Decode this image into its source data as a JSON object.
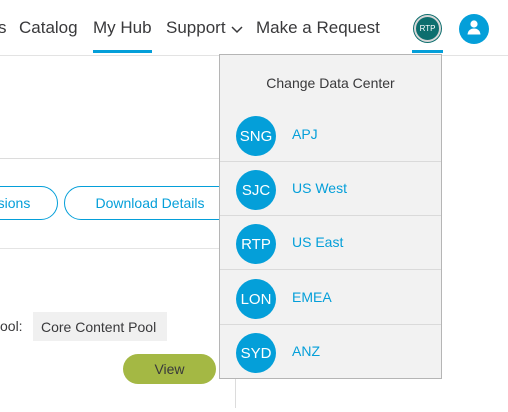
{
  "nav": {
    "partial_item": "s",
    "catalog": "Catalog",
    "my_hub": "My Hub",
    "support": "Support",
    "make_request": "Make a Request",
    "datacenter_badge": "RTP"
  },
  "content": {
    "partial_button": "sions",
    "download_details": "Download Details",
    "pool_label": "ool:",
    "pool_value": "Core Content Pool",
    "view_button": "View"
  },
  "datacenter_menu": {
    "title": "Change Data Center",
    "items": [
      {
        "code": "SNG",
        "name": "APJ"
      },
      {
        "code": "SJC",
        "name": "US West"
      },
      {
        "code": "RTP",
        "name": "US East"
      },
      {
        "code": "LON",
        "name": "EMEA"
      },
      {
        "code": "SYD",
        "name": "ANZ"
      }
    ]
  },
  "colors": {
    "accent": "#049fd9",
    "view_button": "#a4b844",
    "badge": "#0d6e6e"
  },
  "icons": [
    "chevron-down-icon",
    "user-icon"
  ]
}
